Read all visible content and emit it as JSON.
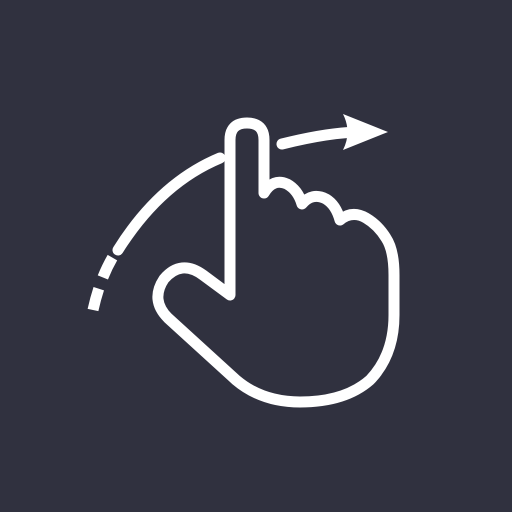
{
  "icon": {
    "name": "swipe-gesture-icon",
    "background_color": "#30313f",
    "stroke_color": "#ffffff"
  }
}
